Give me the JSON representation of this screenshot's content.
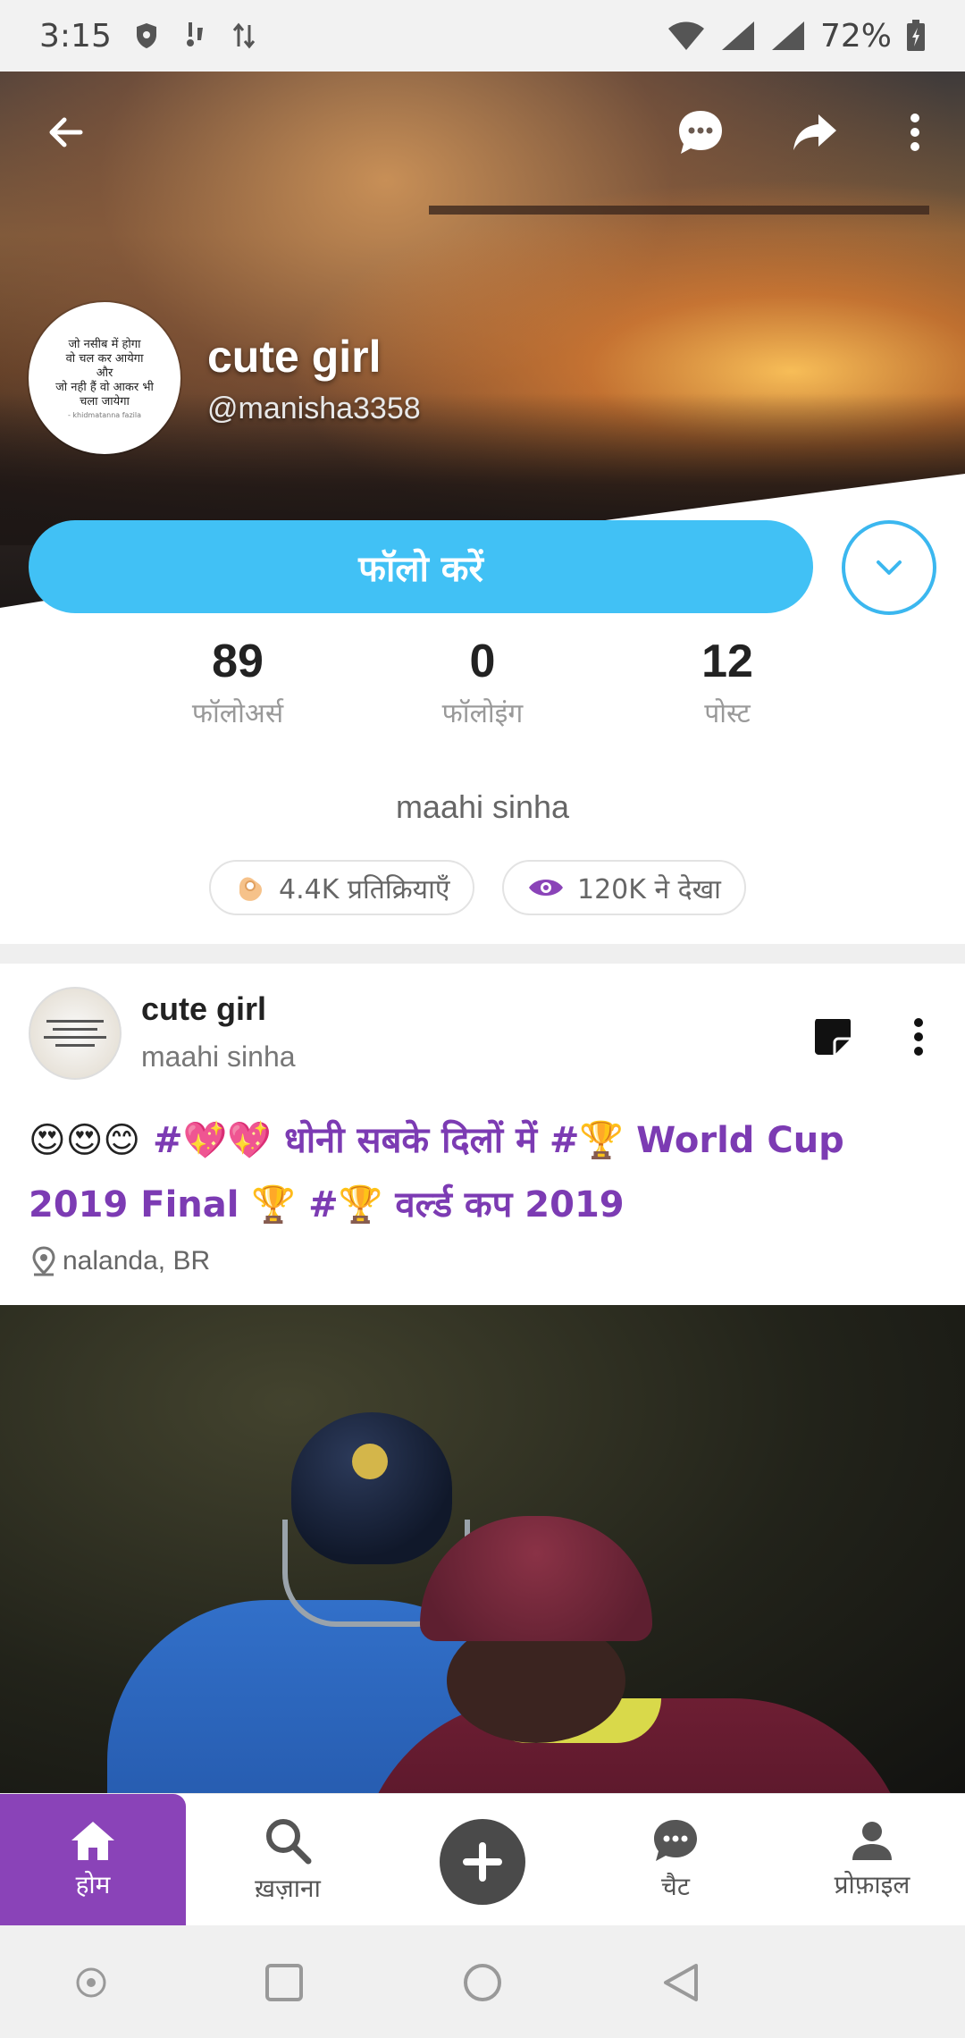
{
  "status_bar": {
    "time": "3:15",
    "battery": "72%",
    "icons": [
      "shield-icon",
      "notification-icon",
      "data-transfer-icon",
      "wifi-icon",
      "signal-icon",
      "signal-icon",
      "battery-icon"
    ]
  },
  "header": {
    "icons": [
      "back-arrow-icon",
      "chat-bubble-icon",
      "share-icon",
      "more-vertical-icon"
    ]
  },
  "profile": {
    "name": "cute girl",
    "handle": "@manisha3358",
    "avatar_text": [
      "जो नसीब में होगा",
      "वो चल कर आयेगा",
      "और",
      "जो नही हैं वो आकर भी",
      "चला जायेगा"
    ],
    "avatar_signature": "- khidmatanna fazila",
    "follow_label": "फॉलो करें",
    "bio": "maahi sinha"
  },
  "stats": [
    {
      "value": "89",
      "label": "फॉलोअर्स"
    },
    {
      "value": "0",
      "label": "फॉलोइंग"
    },
    {
      "value": "12",
      "label": "पोस्ट"
    }
  ],
  "chips": {
    "reactions": "4.4K प्रतिक्रियाएँ",
    "views": "120K ने देखा"
  },
  "post": {
    "author": "cute girl",
    "subtitle": "maahi sinha",
    "caption_emoji_lead": "😍😍😊",
    "caption_line1": "#💖💖 धोनी सबके दिलों में #🏆 World Cup",
    "caption_line2": "2019 Final 🏆 #🏆 वर्ल्ड कप 2019",
    "location": "nalanda, BR"
  },
  "bottom_nav": {
    "items": [
      {
        "label": "होम",
        "icon": "home-icon"
      },
      {
        "label": "ख़ज़ाना",
        "icon": "search-icon"
      },
      {
        "label": "",
        "icon": "plus-icon"
      },
      {
        "label": "चैट",
        "icon": "chat-icon"
      },
      {
        "label": "प्रोफ़ाइल",
        "icon": "person-icon"
      }
    ]
  },
  "colors": {
    "accent_blue": "#41c1f5",
    "accent_purple": "#8a43b8",
    "caption_purple": "#7c3bb3"
  }
}
